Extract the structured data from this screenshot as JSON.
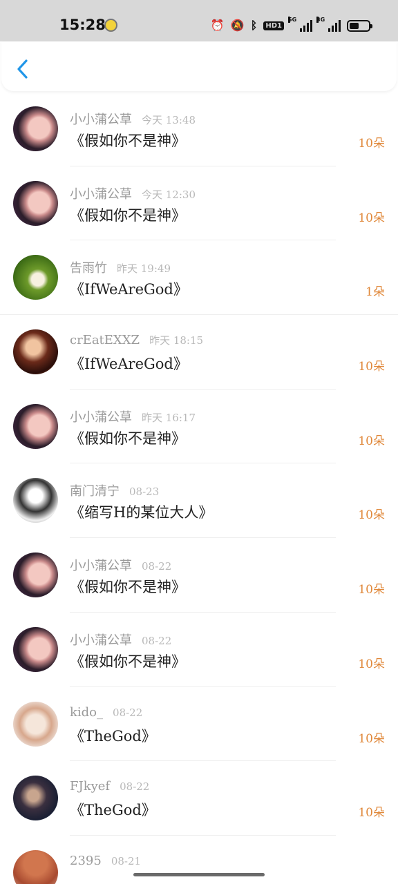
{
  "status_bar": {
    "time": "15:28",
    "network_5g": "5G",
    "network_3g": "3G",
    "hd_badge": "HD1"
  },
  "nav": {
    "back_icon": "chevron-left-icon",
    "accent": "#2196e8"
  },
  "colors": {
    "count": "#e0883a",
    "username": "#9a9a9a",
    "title": "#222222"
  },
  "gifts": [
    {
      "user": "小小蒲公草",
      "time": "今天 13:48",
      "book": "《假如你不是神》",
      "count": "10朵",
      "avatar": "av-face1"
    },
    {
      "user": "小小蒲公草",
      "time": "今天 12:30",
      "book": "《假如你不是神》",
      "count": "10朵",
      "avatar": "av-face1"
    },
    {
      "user": "告雨竹",
      "time": "昨天 19:49",
      "book": "《IfWeAreGod》",
      "count": "1朵",
      "avatar": "av-cat"
    },
    {
      "user": "crEatEXXZ",
      "time": "昨天 18:15",
      "book": "《IfWeAreGod》",
      "count": "10朵",
      "avatar": "av-anime1"
    },
    {
      "user": "小小蒲公草",
      "time": "昨天 16:17",
      "book": "《假如你不是神》",
      "count": "10朵",
      "avatar": "av-face1"
    },
    {
      "user": "南门清宁",
      "time": "08-23",
      "book": "《缩写H的某位大人》",
      "count": "10朵",
      "avatar": "av-bw"
    },
    {
      "user": "小小蒲公草",
      "time": "08-22",
      "book": "《假如你不是神》",
      "count": "10朵",
      "avatar": "av-face1"
    },
    {
      "user": "小小蒲公草",
      "time": "08-22",
      "book": "《假如你不是神》",
      "count": "10朵",
      "avatar": "av-face1"
    },
    {
      "user": "kido_",
      "time": "08-22",
      "book": "《TheGod》",
      "count": "10朵",
      "avatar": "av-sketch"
    },
    {
      "user": "FJkyef",
      "time": "08-22",
      "book": "《TheGod》",
      "count": "10朵",
      "avatar": "av-dark"
    },
    {
      "user": "2395",
      "time": "08-21",
      "book": "",
      "count": "",
      "avatar": "av-red"
    }
  ]
}
